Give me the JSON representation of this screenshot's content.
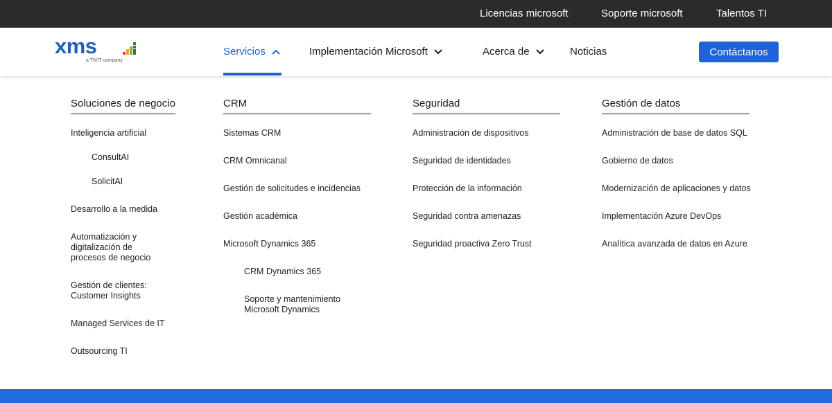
{
  "topbar": {
    "links": [
      "Licencias microsoft",
      "Soporte microsoft",
      "Talentos TI"
    ]
  },
  "logo": {
    "word": "xms",
    "tagline": "a TIVIT company",
    "bar_colors": [
      "#e53935",
      "#f5a623",
      "#7cb342",
      "#2e7d32"
    ]
  },
  "nav": {
    "items": [
      "Servicios",
      "Implementación Microsoft",
      "Acerca de",
      "Noticias"
    ],
    "active": "Servicios",
    "cta": "Contáctanos"
  },
  "colors": {
    "accent": "#1f62d6",
    "topbar_bg": "#2b2b2b"
  },
  "mega_menu": {
    "columns": [
      {
        "title": "Soluciones de negocio",
        "links": [
          "Inteligencia artificial",
          "ConsultAI",
          "SolicitAI",
          "Desarrollo a la medida",
          "Automatización y digitalización de procesos de negocio",
          "Gestión de clientes: Customer Insights",
          "Managed Services de IT",
          "Outsourcing TI"
        ]
      },
      {
        "title": "CRM",
        "links": [
          "Sistemas CRM",
          "CRM Omnicanal",
          "Gestión de solicitudes e incidencias",
          "Gestión académica",
          "Microsoft Dynamics 365",
          "CRM Dynamics 365",
          "Soporte y mantenimiento Microsoft Dynamics"
        ]
      },
      {
        "title": "Seguridad",
        "links": [
          "Administración de dispositivos",
          "Seguridad de identidades",
          "Protección de la información",
          "Seguridad contra amenazas",
          "Seguridad proactiva Zero Trust"
        ]
      },
      {
        "title": "Gestión de datos",
        "links": [
          "Administración de base de datos SQL",
          "Gobierno de datos",
          "Modernización de aplicaciones y datos",
          "Implementación Azure DevOps",
          "Analítica avanzada de datos en Azure"
        ]
      }
    ]
  }
}
